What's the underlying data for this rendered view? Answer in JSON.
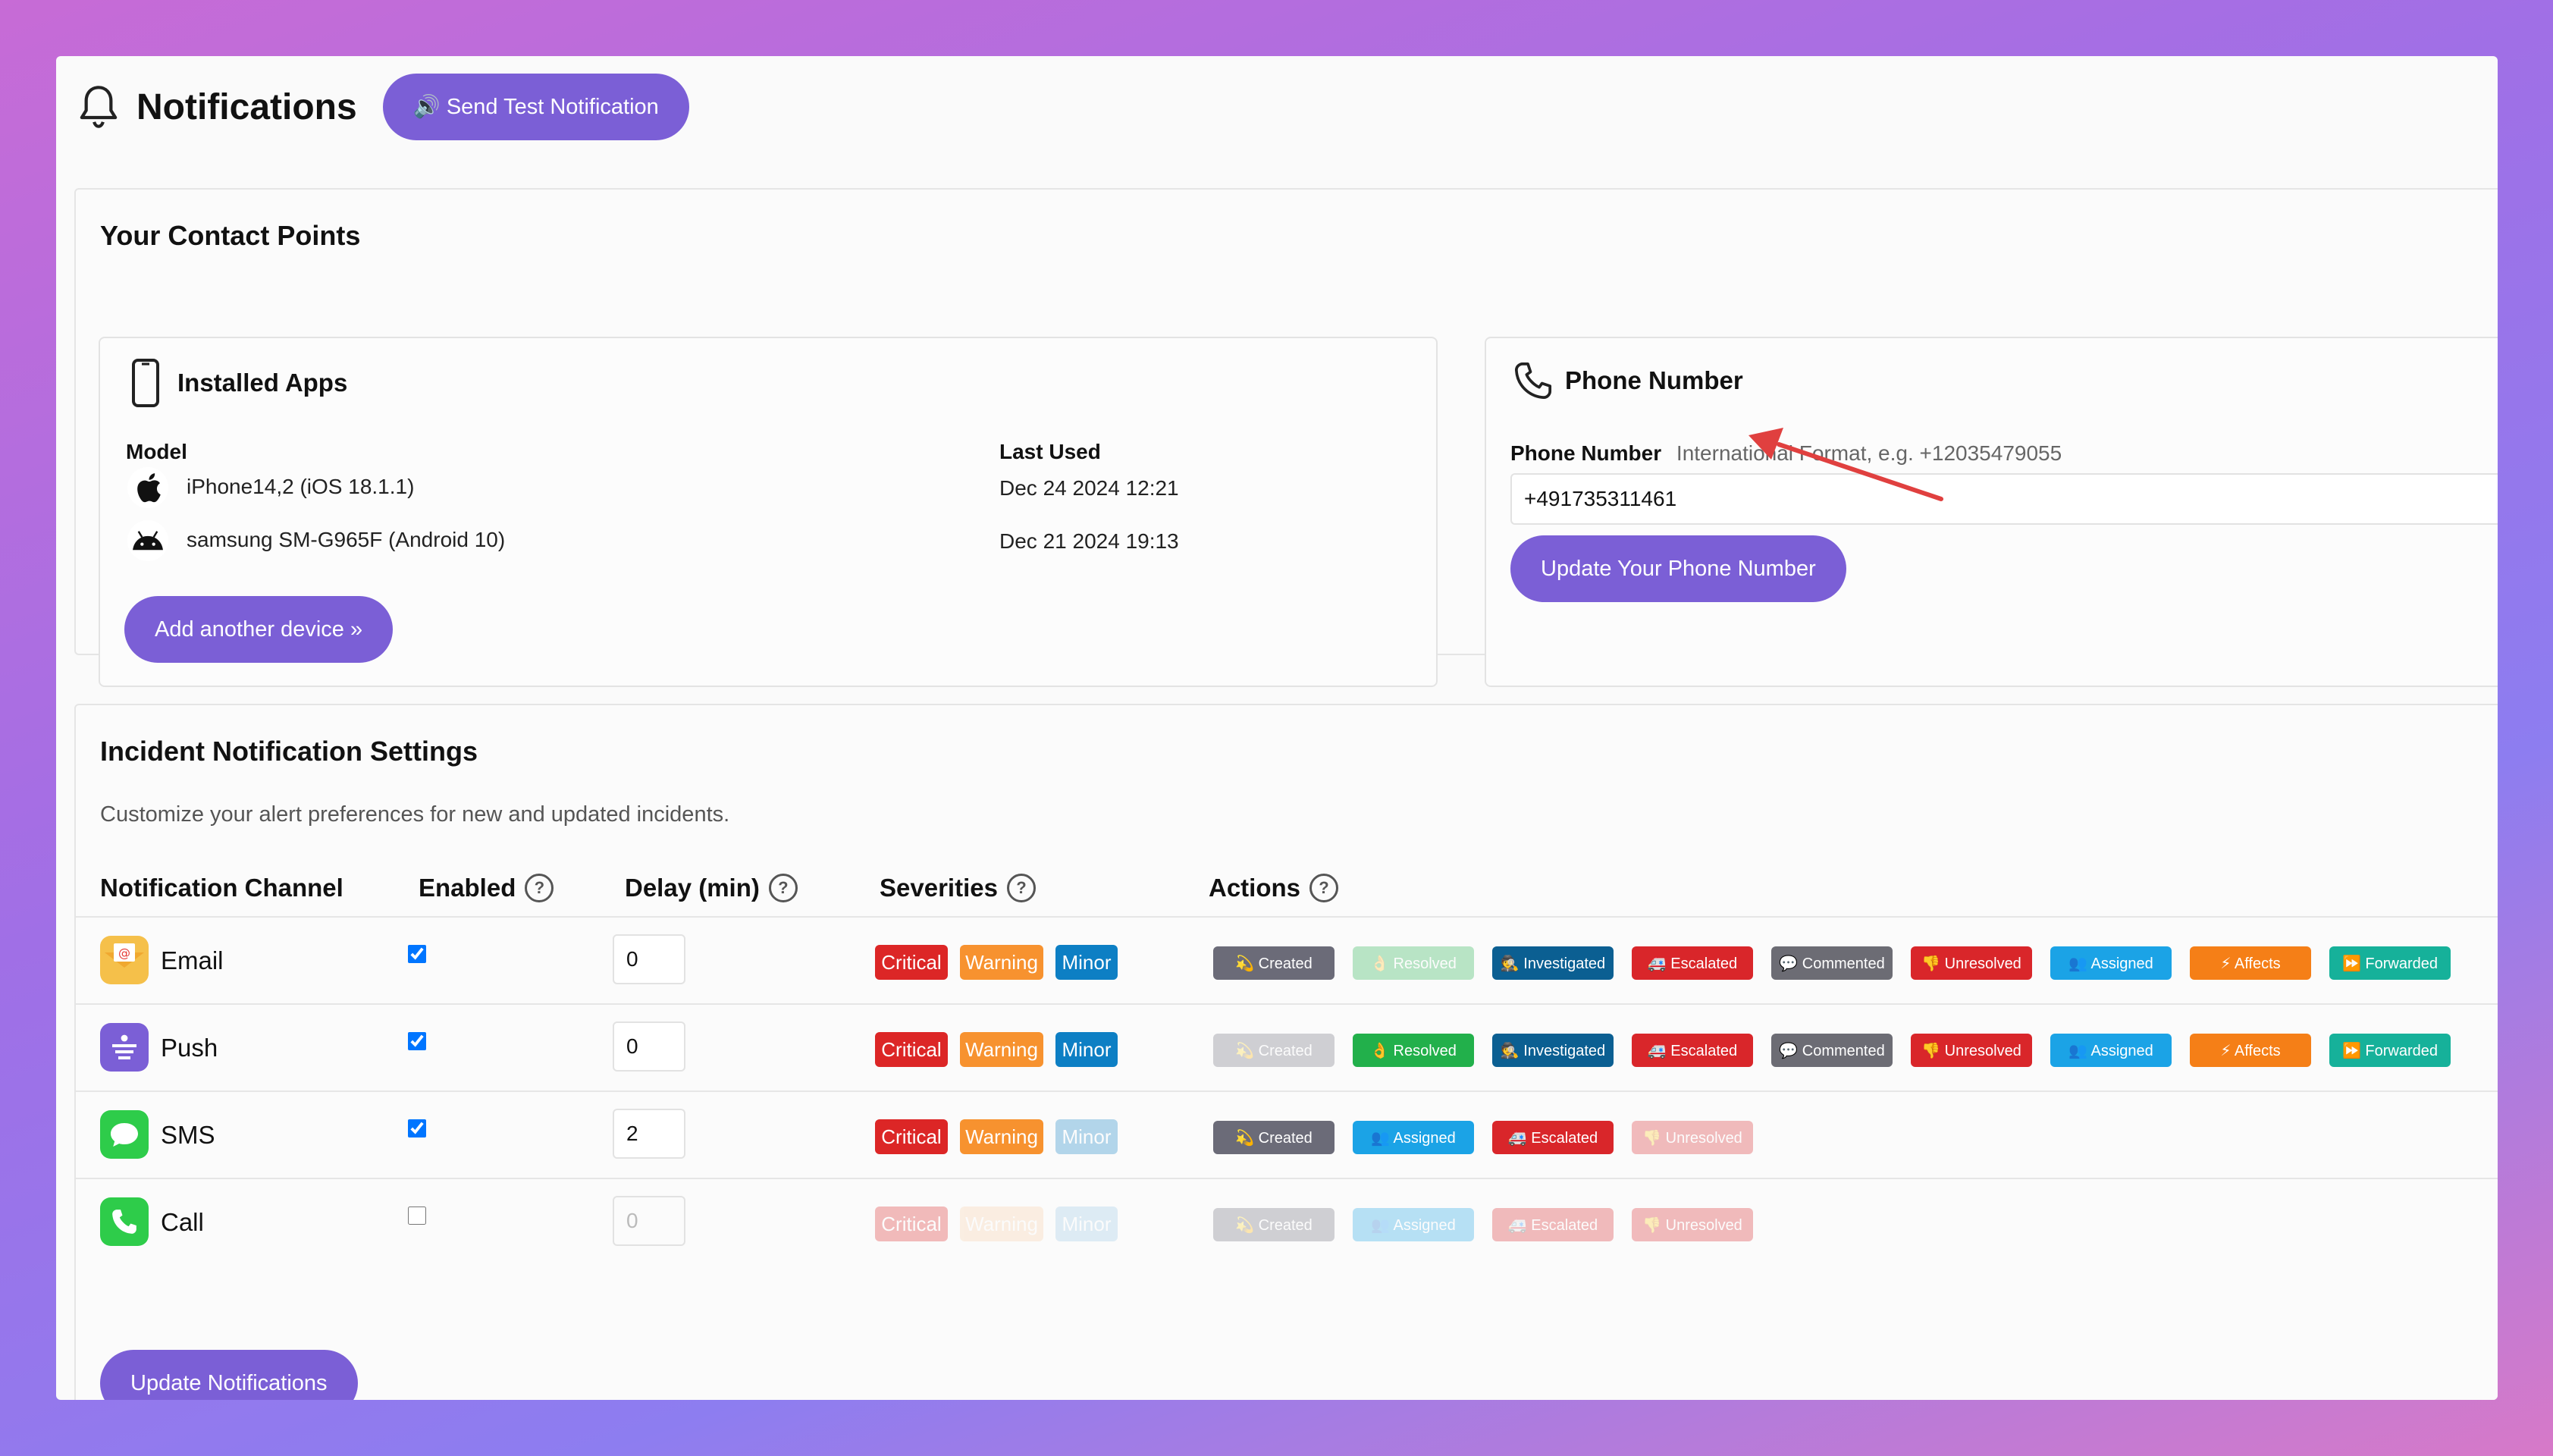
{
  "header": {
    "title": "Notifications",
    "test_button": "🔊 Send Test Notification"
  },
  "contact": {
    "title": "Your Contact Points",
    "apps": {
      "title": "Installed Apps",
      "col_model": "Model",
      "col_last_used": "Last Used",
      "devices": [
        {
          "model": "iPhone14,2 (iOS 18.1.1)",
          "last_used": "Dec 24 2024 12:21",
          "icon": "apple-icon"
        },
        {
          "model": "samsung SM-G965F (Android 10)",
          "last_used": "Dec 21 2024 19:13",
          "icon": "android-icon"
        }
      ],
      "add_button": "Add another device »"
    },
    "phone": {
      "title": "Phone Number",
      "label": "Phone Number",
      "hint": "International Format, e.g. +12035479055",
      "value": "+491735311461",
      "update_button": "Update Your Phone Number"
    }
  },
  "incident": {
    "title": "Incident Notification Settings",
    "description": "Customize your alert preferences for new and updated incidents.",
    "columns": {
      "channel": "Notification Channel",
      "enabled": "Enabled",
      "delay": "Delay (min)",
      "severities": "Severities",
      "actions": "Actions"
    },
    "help_glyph": "?",
    "severity_labels": {
      "critical": "Critical",
      "warning": "Warning",
      "minor": "Minor"
    },
    "action_labels": {
      "created": "💫 Created",
      "resolved": "👌 Resolved",
      "investigated": "🕵 Investigated",
      "escalated": "🚑 Escalated",
      "commented": "💬 Commented",
      "unresolved": "👎 Unresolved",
      "assigned": "👥 Assigned",
      "affects": "⚡ Affects",
      "forwarded": "⏩ Forwarded"
    },
    "channels": [
      {
        "name": "Email",
        "enabled": true,
        "delay": "0"
      },
      {
        "name": "Push",
        "enabled": true,
        "delay": "0"
      },
      {
        "name": "SMS",
        "enabled": true,
        "delay": "2"
      },
      {
        "name": "Call",
        "enabled": false,
        "delay": "0"
      }
    ],
    "update_button": "Update Notifications"
  },
  "colors": {
    "accent": "#7b5fd6",
    "critical": "#dc2626",
    "warning": "#f7922f",
    "minor": "#0d7fc4",
    "created": "#6b6b78",
    "resolved": "#22b04b",
    "investigated": "#0b5f92",
    "escalated": "#d9262a",
    "commented": "#6c6c74",
    "unresolved": "#d9262a",
    "assigned": "#1ba3e6",
    "affects": "#f57f17",
    "forwarded": "#16b19a",
    "annotation_arrow": "#e0403f"
  }
}
